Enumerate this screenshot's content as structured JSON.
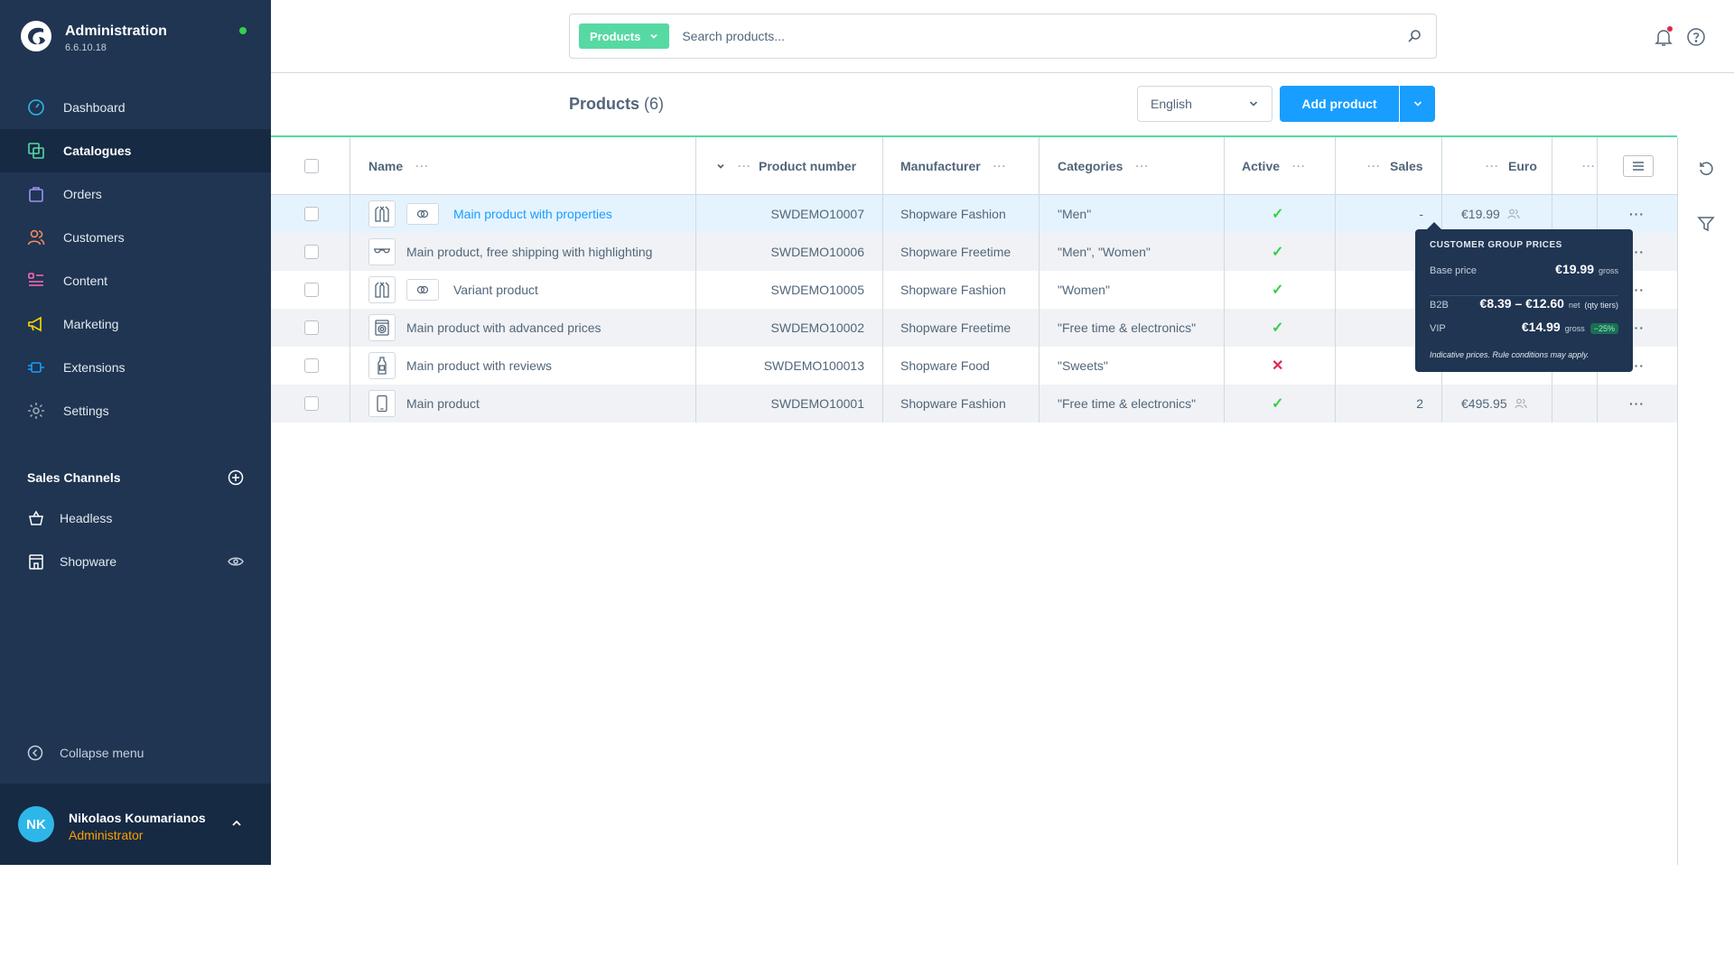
{
  "app": {
    "title": "Administration",
    "version": "6.6.10.18",
    "online_color": "#37d046"
  },
  "sidebar": {
    "items": [
      {
        "label": "Dashboard",
        "icon": "gauge-icon",
        "active": false
      },
      {
        "label": "Catalogues",
        "icon": "catalogue-icon",
        "active": true
      },
      {
        "label": "Orders",
        "icon": "shopping-bag-icon",
        "active": false
      },
      {
        "label": "Customers",
        "icon": "users-icon",
        "active": false
      },
      {
        "label": "Content",
        "icon": "content-list-icon",
        "active": false
      },
      {
        "label": "Marketing",
        "icon": "megaphone-icon",
        "active": false
      },
      {
        "label": "Extensions",
        "icon": "plug-icon",
        "active": false
      },
      {
        "label": "Settings",
        "icon": "gear-icon",
        "active": false
      }
    ],
    "sales_channels_title": "Sales Channels",
    "sales_channels": [
      {
        "label": "Headless",
        "icon": "basket-icon"
      },
      {
        "label": "Shopware",
        "icon": "storefront-icon"
      }
    ],
    "collapse_label": "Collapse menu"
  },
  "user": {
    "initials": "NK",
    "name": "Nikolaos Koumarianos",
    "role": "Administrator"
  },
  "search": {
    "type_label": "Products",
    "placeholder": "Search products..."
  },
  "page": {
    "title": "Products",
    "count": "(6)",
    "language": "English",
    "add_button": "Add product"
  },
  "grid": {
    "columns": [
      "Name",
      "Product number",
      "Manufacturer",
      "Categories",
      "Active",
      "Sales",
      "Euro"
    ],
    "rows": [
      {
        "name": "Main product with properties",
        "is_link": true,
        "has_variant_badge": true,
        "thumb": "jacket-icon",
        "number": "SWDEMO10007",
        "manufacturer": "Shopware Fashion",
        "categories": "\"Men\"",
        "active": true,
        "sales": "-",
        "price": "€19.99"
      },
      {
        "name": "Main product, free shipping with highlighting",
        "is_link": false,
        "has_variant_badge": false,
        "thumb": "sunglasses-icon",
        "number": "SWDEMO10006",
        "manufacturer": "Shopware Freetime",
        "categories": "\"Men\", \"Women\"",
        "active": true,
        "sales": "",
        "price": ""
      },
      {
        "name": "Variant product",
        "is_link": false,
        "has_variant_badge": true,
        "thumb": "jacket-icon",
        "number": "SWDEMO10005",
        "manufacturer": "Shopware Fashion",
        "categories": "\"Women\"",
        "active": true,
        "sales": "",
        "price": ""
      },
      {
        "name": "Main product with advanced prices",
        "is_link": false,
        "has_variant_badge": false,
        "thumb": "washing-machine-icon",
        "number": "SWDEMO10002",
        "manufacturer": "Shopware Freetime",
        "categories": "\"Free time & electronics\"",
        "active": true,
        "sales": "",
        "price": ""
      },
      {
        "name": "Main product with reviews",
        "is_link": false,
        "has_variant_badge": false,
        "thumb": "bottle-icon",
        "number": "SWDEMO100013",
        "manufacturer": "Shopware Food",
        "categories": "\"Sweets\"",
        "active": false,
        "sales": "",
        "price": ""
      },
      {
        "name": "Main product",
        "is_link": false,
        "has_variant_badge": false,
        "thumb": "phone-icon",
        "number": "SWDEMO10001",
        "manufacturer": "Shopware Fashion",
        "categories": "\"Free time & electronics\"",
        "active": true,
        "sales": "2",
        "price": "€495.95"
      }
    ]
  },
  "tooltip": {
    "title": "CUSTOMER GROUP PRICES",
    "base_label": "Base price",
    "base_value": "€19.99",
    "base_unit": "gross",
    "b2b_label": "B2B",
    "b2b_value": "€8.39 – €12.60",
    "b2b_unit": "net",
    "b2b_note": "(qty tiers)",
    "vip_label": "VIP",
    "vip_value": "€14.99",
    "vip_unit": "gross",
    "vip_badge": "−25%",
    "note": "Indicative prices. Rule conditions may apply."
  },
  "colors": {
    "sidebar": "#1f3552",
    "accent": "#189eff",
    "brand_green": "#57d9a3",
    "active_check": "#37d046",
    "inactive_cross": "#de294c",
    "role": "#ff9f00"
  }
}
